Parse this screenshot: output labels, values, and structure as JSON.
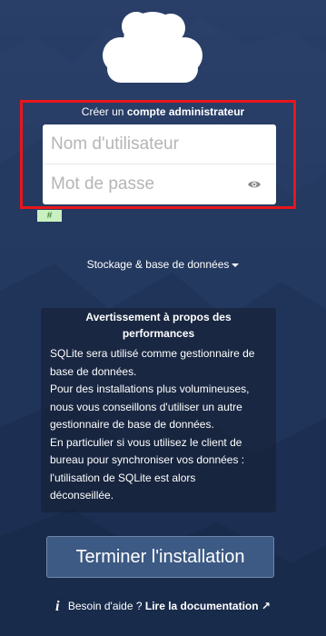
{
  "setup": {
    "create_admin_prefix": "Créer un",
    "create_admin_bold": "compte administrateur",
    "username_placeholder": "Nom d'utilisateur",
    "password_placeholder": "Mot de passe",
    "strength_indicator": "#",
    "storage_label": "Stockage & base de données"
  },
  "warning": {
    "title": "Avertissement à propos des performances",
    "lines": [
      "SQLite sera utilisé comme gestionnaire de",
      "base de données.",
      "Pour des installations plus volumineuses,",
      "nous vous conseillons d'utiliser un autre",
      "gestionnaire de base de données.",
      "En particulier si vous utilisez le client de",
      "bureau pour synchroniser vos données :",
      "l'utilisation de SQLite est alors",
      "déconseillée."
    ]
  },
  "actions": {
    "finish_label": "Terminer l'installation"
  },
  "help": {
    "question": "Besoin d'aide ?",
    "link_label": "Lire la documentation ↗"
  },
  "colors": {
    "highlight": "#e8161b",
    "background": "#1f355f"
  }
}
